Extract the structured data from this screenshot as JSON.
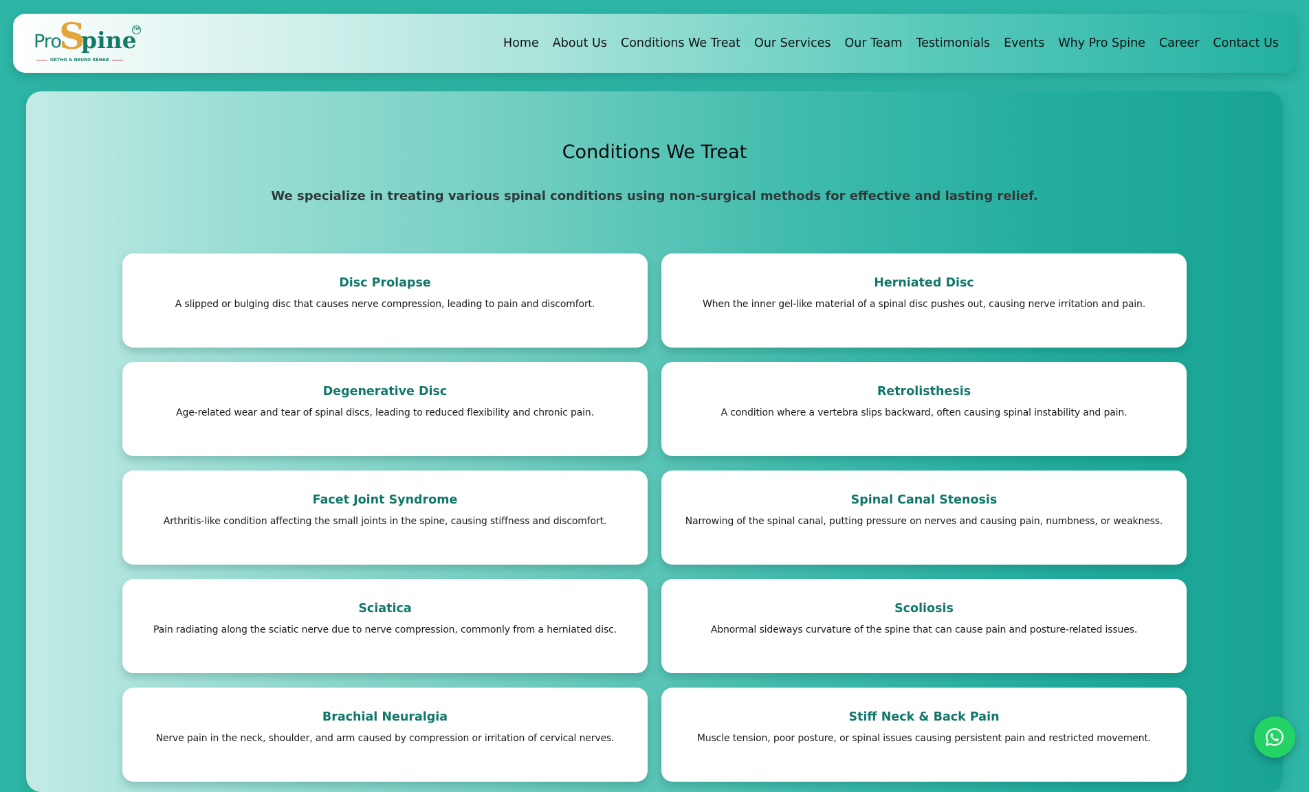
{
  "logo": {
    "pro": "Pro",
    "s": "S",
    "pine": "pine",
    "tm": "TM",
    "tagline": "ORTHO & NEURO REHAB"
  },
  "nav": {
    "items": [
      {
        "label": "Home"
      },
      {
        "label": "About Us"
      },
      {
        "label": "Conditions We Treat"
      },
      {
        "label": "Our Services"
      },
      {
        "label": "Our Team"
      },
      {
        "label": "Testimonials"
      },
      {
        "label": "Events"
      },
      {
        "label": "Why Pro Spine"
      },
      {
        "label": "Career"
      },
      {
        "label": "Contact Us"
      }
    ]
  },
  "section": {
    "title": "Conditions We Treat",
    "subtitle": "We specialize in treating various spinal conditions using non-surgical methods for effective and lasting relief."
  },
  "conditions": [
    {
      "title": "Disc Prolapse",
      "description": "A slipped or bulging disc that causes nerve compression, leading to pain and discomfort."
    },
    {
      "title": "Herniated Disc",
      "description": "When the inner gel-like material of a spinal disc pushes out, causing nerve irritation and pain."
    },
    {
      "title": "Degenerative Disc",
      "description": "Age-related wear and tear of spinal discs, leading to reduced flexibility and chronic pain."
    },
    {
      "title": "Retrolisthesis",
      "description": "A condition where a vertebra slips backward, often causing spinal instability and pain."
    },
    {
      "title": "Facet Joint Syndrome",
      "description": "Arthritis-like condition affecting the small joints in the spine, causing stiffness and discomfort."
    },
    {
      "title": "Spinal Canal Stenosis",
      "description": "Narrowing of the spinal canal, putting pressure on nerves and causing pain, numbness, or weakness."
    },
    {
      "title": "Sciatica",
      "description": "Pain radiating along the sciatic nerve due to nerve compression, commonly from a herniated disc."
    },
    {
      "title": "Scoliosis",
      "description": "Abnormal sideways curvature of the spine that can cause pain and posture-related issues."
    },
    {
      "title": "Brachial Neuralgia",
      "description": "Nerve pain in the neck, shoulder, and arm caused by compression or irritation of cervical nerves."
    },
    {
      "title": "Stiff Neck & Back Pain",
      "description": "Muscle tension, poor posture, or spinal issues causing persistent pain and restricted movement."
    }
  ],
  "whatsapp": {
    "icon": "whatsapp-icon",
    "color": "#23d366"
  },
  "colors": {
    "brand_teal": "#11776a",
    "accent_gold": "#e3a43a",
    "page_background": "#2db5a5"
  }
}
